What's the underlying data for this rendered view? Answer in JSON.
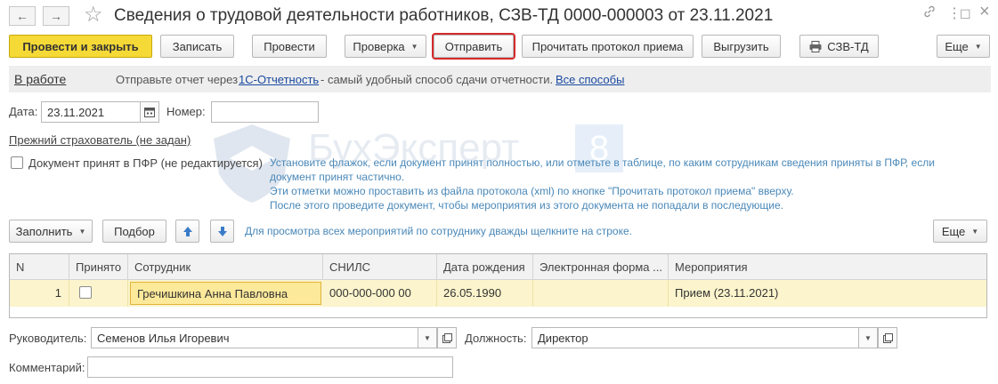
{
  "window": {
    "title": "Сведения о трудовой деятельности работников, СЗВ-ТД 0000-000003 от 23.11.2021",
    "back_icon": "arrow-left-icon",
    "forward_icon": "arrow-right-icon",
    "favorite_icon": "star-icon",
    "link_icon": "link-icon",
    "menu_icon": "more-vertical-icon",
    "maximize_icon": "maximize-icon",
    "close_icon": "close-icon",
    "glyphs": {
      "back": "←",
      "forward": "→",
      "star": "☆",
      "link": "🔗",
      "menu": "⋮",
      "maximize": "☐",
      "close": "×"
    }
  },
  "toolbar": {
    "post_close": "Провести и закрыть",
    "save": "Записать",
    "post": "Провести",
    "check": "Проверка",
    "send": "Отправить",
    "read_protocol": "Прочитать протокол приема",
    "export": "Выгрузить",
    "print_szv": "СЗВ-ТД",
    "more": "Еще",
    "caret": "▼"
  },
  "status": {
    "state": "В работе",
    "msg_before": "Отправьте отчет через",
    "service_link": "1С-Отчетность",
    "msg_after": "- самый удобный способ сдачи отчетности.",
    "all_ways_link": "Все способы"
  },
  "form": {
    "date_label": "Дата:",
    "date_value": "23.11.2021",
    "number_label": "Номер:",
    "number_value": "",
    "prev_insurer": "Прежний страхователь (не задан)",
    "accepted_label": "Документ принят в ПФР (не редактируется)",
    "hint_1": "Установите флажок, если документ принят полностью, или отметьте в таблице, по каким сотрудникам сведения приняты в ПФР, если",
    "hint_2": "документ принят частично.",
    "hint_3": "Эти отметки можно проставить из файла протокола (xml) по кнопке \"Прочитать протокол приема\" вверху.",
    "hint_4": "После этого проведите документ, чтобы мероприятия из этого документа не попадали в последующие."
  },
  "table_toolbar": {
    "fill": "Заполнить",
    "select": "Подбор",
    "up_icon": "arrow-up-icon",
    "down_icon": "arrow-down-icon",
    "hint": "Для просмотра всех мероприятий по сотруднику дважды щелкните на строке.",
    "more": "Еще"
  },
  "table": {
    "columns": [
      "N",
      "Принято",
      "Сотрудник",
      "СНИЛС",
      "Дата рождения",
      "Электронная форма ...",
      "Мероприятия"
    ],
    "rows": [
      {
        "n": "1",
        "accepted": false,
        "employee": "Гречишкина Анна Павловна",
        "snils": "000-000-000 00",
        "birth_date": "26.05.1990",
        "e_form": "",
        "events": "Прием (23.11.2021)"
      }
    ]
  },
  "footer": {
    "head_label": "Руководитель:",
    "head_value": "Семенов Илья Игоревич",
    "position_label": "Должность:",
    "position_value": "Директор",
    "comment_label": "Комментарий:",
    "comment_value": ""
  },
  "colors": {
    "primary_button": "#f5d936",
    "highlight_outline": "#d52a2a",
    "selected_row": "#fbf4cc",
    "hint_text": "#4a88b8",
    "link": "#1a4aa0",
    "green_link": "#3d8a3d"
  }
}
